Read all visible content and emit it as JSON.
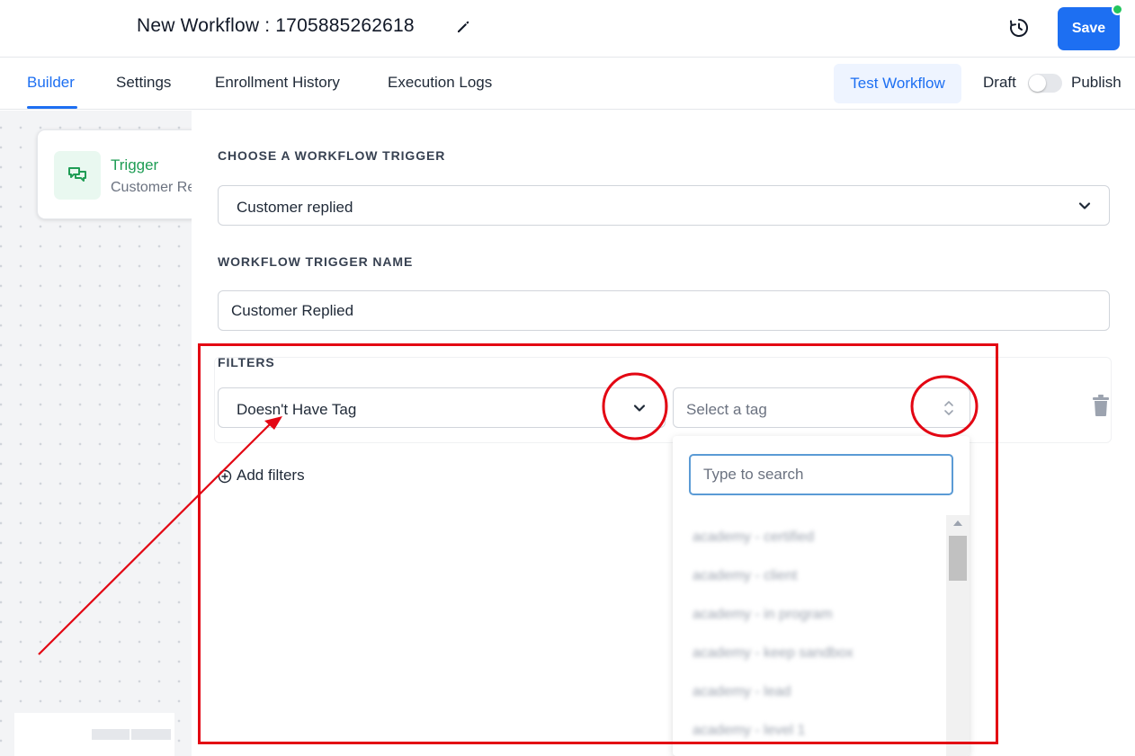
{
  "header": {
    "title": "New Workflow : 1705885262618",
    "save_label": "Save",
    "status_dot_color": "#22c55e"
  },
  "tabs": [
    {
      "label": "Builder",
      "active": true
    },
    {
      "label": "Settings",
      "active": false
    },
    {
      "label": "Enrollment History",
      "active": false
    },
    {
      "label": "Execution Logs",
      "active": false
    }
  ],
  "toolbar": {
    "test_workflow_label": "Test Workflow",
    "draft_label": "Draft",
    "publish_label": "Publish",
    "published": false
  },
  "canvas": {
    "trigger_card": {
      "title": "Trigger",
      "subtitle": "Customer Replied"
    }
  },
  "panel": {
    "trigger_section_label": "CHOOSE A WORKFLOW TRIGGER",
    "trigger_value": "Customer replied",
    "name_section_label": "WORKFLOW TRIGGER NAME",
    "name_value": "Customer Replied",
    "filters_label": "FILTERS",
    "filter_condition": "Doesn't Have Tag",
    "tag_placeholder": "Select a tag",
    "add_filters_label": "Add filters"
  },
  "tag_dropdown": {
    "search_placeholder": "Type to search",
    "items": [
      "academy - certified",
      "academy - client",
      "academy - in program",
      "academy - keep sandbox",
      "academy - lead",
      "academy - level 1"
    ]
  },
  "colors": {
    "accent": "#1d6ff2",
    "trigger_green": "#1f9d55",
    "annotation_red": "#e30613"
  }
}
